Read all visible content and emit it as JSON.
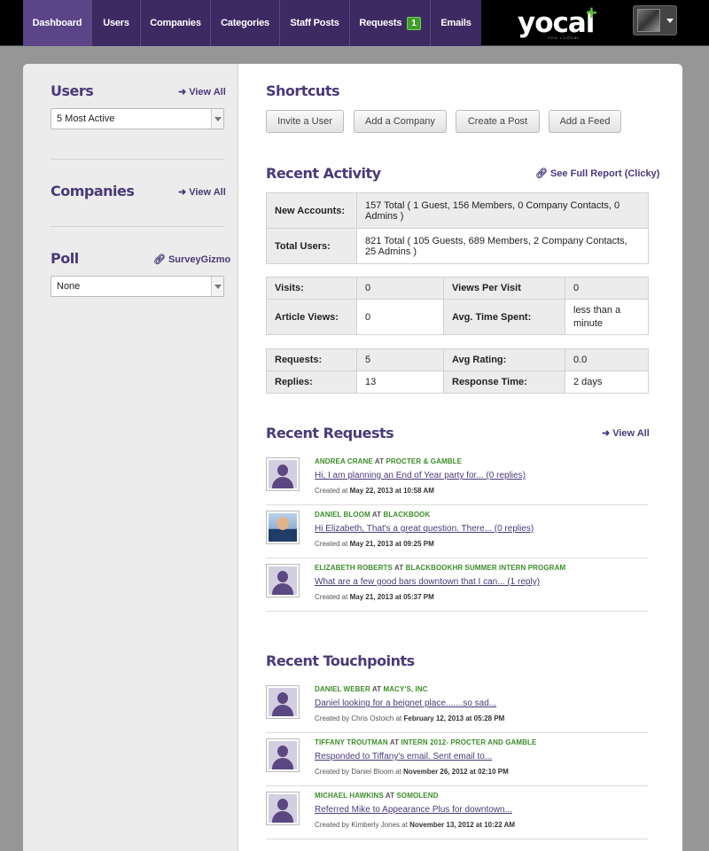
{
  "nav": {
    "items": [
      {
        "label": "Dashboard",
        "active": true
      },
      {
        "label": "Users"
      },
      {
        "label": "Companies"
      },
      {
        "label": "Categories"
      },
      {
        "label": "Staff Posts"
      },
      {
        "label": "Requests",
        "badge": "1"
      },
      {
        "label": "Emails"
      }
    ]
  },
  "brand": {
    "logo": "yocal",
    "plus": "+",
    "tagline": "YOU • LOCAL"
  },
  "sidebar": {
    "users": {
      "title": "Users",
      "view_all": "View All",
      "select_value": "5 Most Active"
    },
    "companies": {
      "title": "Companies",
      "view_all": "View All"
    },
    "poll": {
      "title": "Poll",
      "link": "SurveyGizmo",
      "select_value": "None"
    }
  },
  "shortcuts": {
    "title": "Shortcuts",
    "buttons": [
      "Invite a User",
      "Add a Company",
      "Create a Post",
      "Add a Feed"
    ]
  },
  "activity": {
    "title": "Recent Activity",
    "report_link": "See Full Report (Clicky)",
    "accounts": [
      {
        "label": "New Accounts:",
        "value": "157 Total ( 1 Guest, 156 Members, 0 Company Contacts, 0 Admins )"
      },
      {
        "label": "Total Users:",
        "value": "821 Total ( 105 Guests, 689 Members, 2 Company Contacts, 25 Admins )"
      }
    ],
    "visits": [
      {
        "l1": "Visits:",
        "v1": "0",
        "l2": "Views Per Visit",
        "v2": "0"
      },
      {
        "l1": "Article Views:",
        "v1": "0",
        "l2": "Avg. Time Spent:",
        "v2": "less than a minute"
      }
    ],
    "requests": [
      {
        "l1": "Requests:",
        "v1": "5",
        "l2": "Avg Rating:",
        "v2": "0.0"
      },
      {
        "l1": "Replies:",
        "v1": "13",
        "l2": "Response Time:",
        "v2": "2 days"
      }
    ]
  },
  "recent_requests": {
    "title": "Recent Requests",
    "view_all": "View All",
    "items": [
      {
        "name": "Andrea Crane",
        "at": "at",
        "company": "Procter & Gamble",
        "message": "Hi, I am planning an End of Year party for... (0 replies)",
        "meta_prefix": "Created at",
        "date": "May 22, 2013 at 10:58 AM",
        "photo": false
      },
      {
        "name": "Daniel Bloom",
        "at": "at",
        "company": "BlackBook",
        "message": "Hi Elizabeth, That's a great question. There... (0 replies)",
        "meta_prefix": "Created at",
        "date": "May 21, 2013 at 09:25 PM",
        "photo": true
      },
      {
        "name": "Elizabeth Roberts",
        "at": "at",
        "company": "BlackBookHR Summer Intern Program",
        "message": "What are a few good bars downtown that I can... (1 reply)",
        "meta_prefix": "Created at",
        "date": "May 21, 2013 at 05:37 PM",
        "photo": false
      }
    ]
  },
  "recent_touchpoints": {
    "title": "Recent Touchpoints",
    "items": [
      {
        "name": "Daniel Weber",
        "at": "at",
        "company": "Macy's, Inc",
        "message": "Daniel looking for a beignet place.......so sad...",
        "meta_prefix": "Created by Chris Ostoich at",
        "date": "February 12, 2013 at 05:28 PM"
      },
      {
        "name": "Tiffany Troutman",
        "at": "at",
        "company": "Intern 2012- Procter and Gamble",
        "message": "Responded to Tiffany's email. Sent email to...",
        "meta_prefix": "Created by Daniel Bloom at",
        "date": "November 26, 2012 at 02:10 PM"
      },
      {
        "name": "Michael Hawkins",
        "at": "at",
        "company": "SomoLend",
        "message": "Referred Mike to Appearance Plus for downtown...",
        "meta_prefix": "Created by Kimberly Jones at",
        "date": "November 13, 2012 at 10:22 AM"
      }
    ]
  },
  "colors": {
    "nav_bg": "#3e2a62",
    "nav_active": "#5b4488",
    "accent_purple": "#4a3a78",
    "accent_green": "#3c8d2a",
    "badge_green": "#3f9c2d"
  }
}
